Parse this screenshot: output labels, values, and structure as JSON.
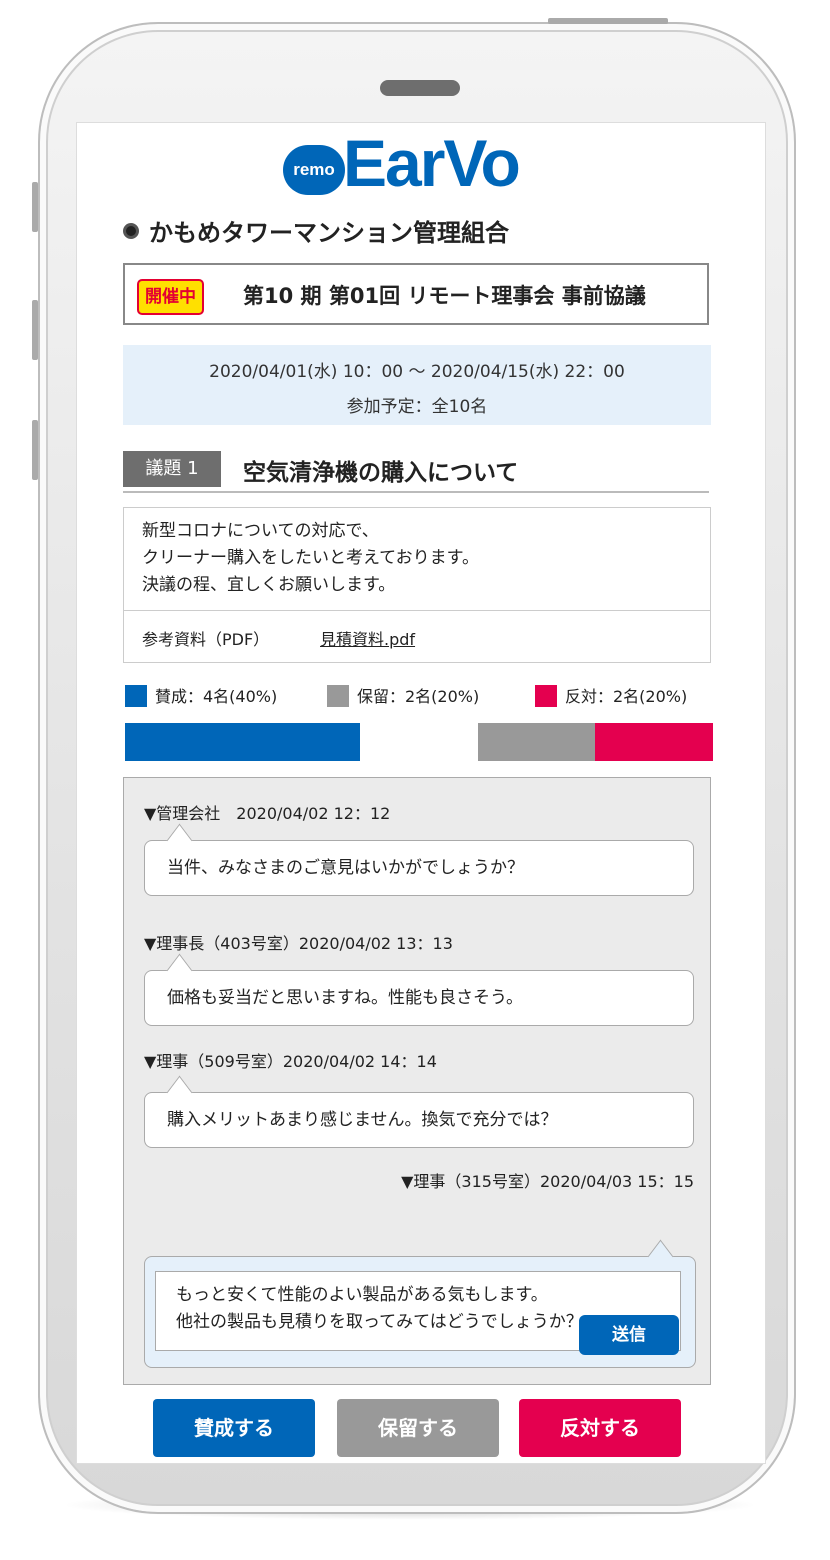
{
  "brand": {
    "badge": "remo",
    "name": "EarVo",
    "color": "#0066b8"
  },
  "org_name": "かもめタワーマンション管理組合",
  "meeting": {
    "status": "開催中",
    "title": "第10 期 第01回 リモート理事会 事前協議"
  },
  "schedule": {
    "period": "2020/04/01(水) 10：00 ～ 2020/04/15(水) 22：00",
    "participants": "参加予定：全10名"
  },
  "topic": {
    "number": "議題 1",
    "title": "空気清浄機の購入について",
    "description": [
      "新型コロナについての対応で、",
      "クリーナー購入をしたいと考えております。",
      "決議の程、宜しくお願いします。"
    ],
    "reference_label": "参考資料（PDF）",
    "reference_file": "見積資料.pdf"
  },
  "votes": {
    "legend": [
      {
        "label": "賛成：4名(40%)",
        "color": "#0066b8",
        "percent": 40
      },
      {
        "label": "保留：2名(20%)",
        "color": "#999999",
        "percent": 20
      },
      {
        "label": "反対：2名(20%)",
        "color": "#e4004f",
        "percent": 20
      }
    ],
    "unvoted_percent": 20
  },
  "comments": [
    {
      "author": "▼管理会社　2020/04/02 12：12",
      "text": "当件、みなさまのご意見はいかがでしょうか？"
    },
    {
      "author": "▼理事長（403号室）2020/04/02 13：13",
      "text": "価格も妥当だと思いますね。性能も良さそう。"
    },
    {
      "author": "▼理事（509号室）2020/04/02 14：14",
      "text": "購入メリットあまり感じません。換気で充分では？"
    }
  ],
  "reply": {
    "author": "▼理事（315号室）2020/04/03 15：15",
    "text": "もっと安くて性能のよい製品がある気もします。\n他社の製品も見積りを取ってみてはどうでしょうか？",
    "send_label": "送信"
  },
  "actions": {
    "approve": "賛成する",
    "hold": "保留する",
    "oppose": "反対する"
  }
}
